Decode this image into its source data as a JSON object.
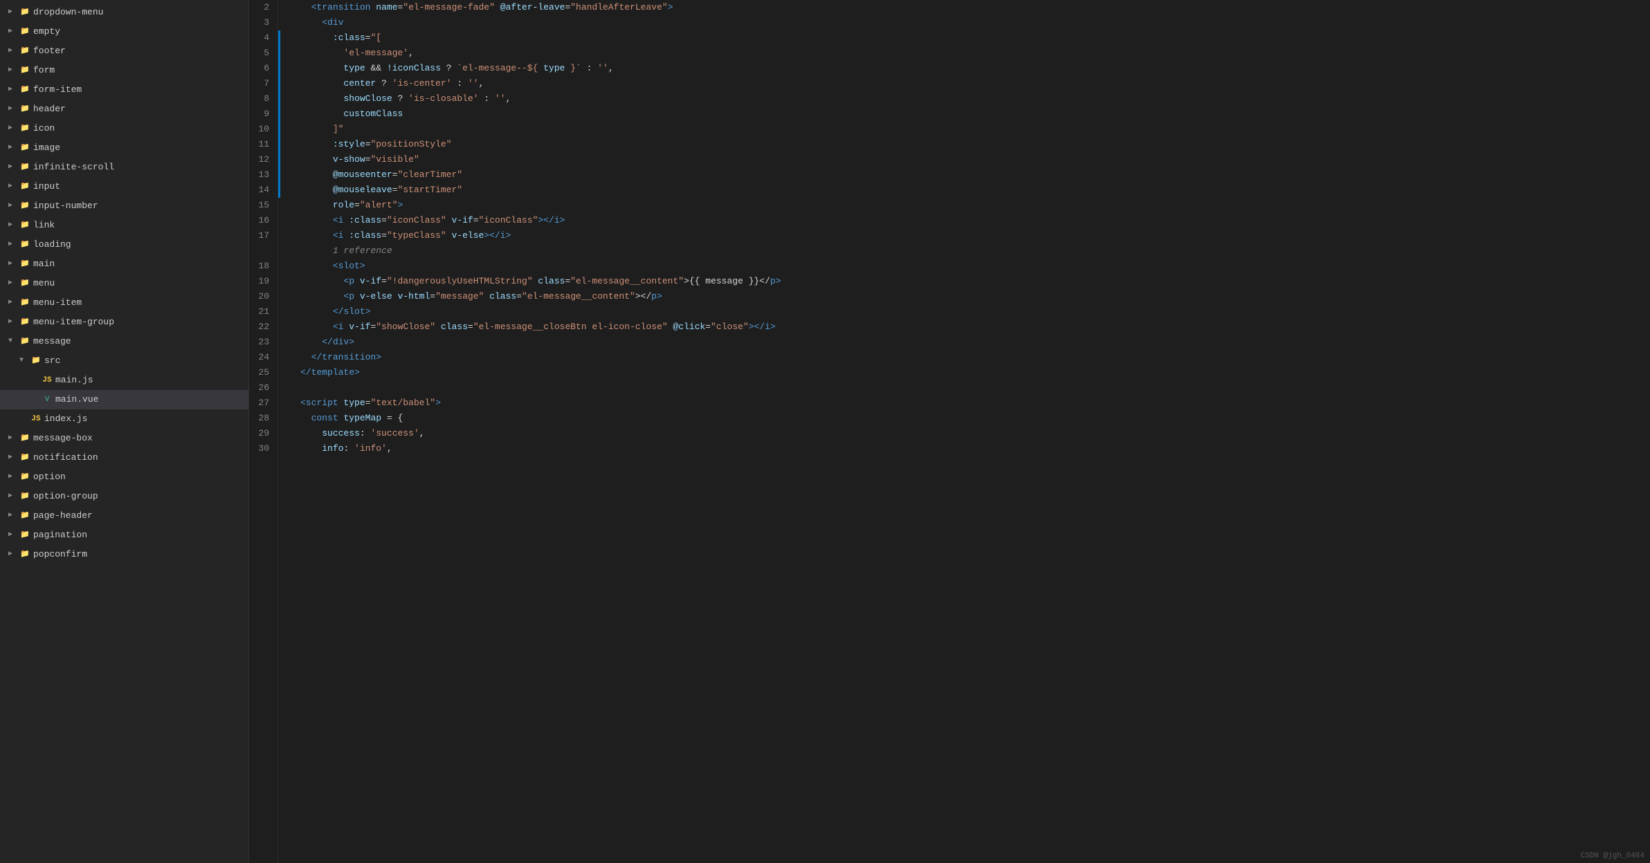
{
  "sidebar": {
    "items": [
      {
        "id": "dropdown-menu",
        "label": "dropdown-menu",
        "type": "folder",
        "collapsed": true,
        "indent": 0
      },
      {
        "id": "empty",
        "label": "empty",
        "type": "folder",
        "collapsed": true,
        "indent": 0
      },
      {
        "id": "footer",
        "label": "footer",
        "type": "folder",
        "collapsed": true,
        "indent": 0
      },
      {
        "id": "form",
        "label": "form",
        "type": "folder",
        "collapsed": true,
        "indent": 0
      },
      {
        "id": "form-item",
        "label": "form-item",
        "type": "folder",
        "collapsed": true,
        "indent": 0
      },
      {
        "id": "header",
        "label": "header",
        "type": "folder",
        "collapsed": true,
        "indent": 0
      },
      {
        "id": "icon",
        "label": "icon",
        "type": "folder",
        "collapsed": true,
        "indent": 0
      },
      {
        "id": "image",
        "label": "image",
        "type": "folder",
        "collapsed": true,
        "indent": 0
      },
      {
        "id": "infinite-scroll",
        "label": "infinite-scroll",
        "type": "folder",
        "collapsed": true,
        "indent": 0
      },
      {
        "id": "input",
        "label": "input",
        "type": "folder",
        "collapsed": true,
        "indent": 0
      },
      {
        "id": "input-number",
        "label": "input-number",
        "type": "folder",
        "collapsed": true,
        "indent": 0
      },
      {
        "id": "link",
        "label": "link",
        "type": "folder",
        "collapsed": true,
        "indent": 0
      },
      {
        "id": "loading",
        "label": "loading",
        "type": "folder",
        "collapsed": true,
        "indent": 0
      },
      {
        "id": "main",
        "label": "main",
        "type": "folder",
        "collapsed": true,
        "indent": 0
      },
      {
        "id": "menu",
        "label": "menu",
        "type": "folder",
        "collapsed": true,
        "indent": 0
      },
      {
        "id": "menu-item",
        "label": "menu-item",
        "type": "folder",
        "collapsed": true,
        "indent": 0
      },
      {
        "id": "menu-item-group",
        "label": "menu-item-group",
        "type": "folder",
        "collapsed": true,
        "indent": 0
      },
      {
        "id": "message",
        "label": "message",
        "type": "folder",
        "collapsed": false,
        "indent": 0
      },
      {
        "id": "src",
        "label": "src",
        "type": "folder",
        "collapsed": false,
        "indent": 1
      },
      {
        "id": "main-js",
        "label": "main.js",
        "type": "js",
        "indent": 2
      },
      {
        "id": "main-vue",
        "label": "main.vue",
        "type": "vue",
        "indent": 2,
        "selected": true
      },
      {
        "id": "index-js",
        "label": "index.js",
        "type": "js",
        "indent": 1
      },
      {
        "id": "message-box",
        "label": "message-box",
        "type": "folder",
        "collapsed": true,
        "indent": 0
      },
      {
        "id": "notification",
        "label": "notification",
        "type": "folder",
        "collapsed": true,
        "indent": 0
      },
      {
        "id": "option",
        "label": "option",
        "type": "folder",
        "collapsed": true,
        "indent": 0
      },
      {
        "id": "option-group",
        "label": "option-group",
        "type": "folder",
        "collapsed": true,
        "indent": 0
      },
      {
        "id": "page-header",
        "label": "page-header",
        "type": "folder",
        "collapsed": true,
        "indent": 0
      },
      {
        "id": "pagination",
        "label": "pagination",
        "type": "folder",
        "collapsed": true,
        "indent": 0
      },
      {
        "id": "popconfirm",
        "label": "popconfirm",
        "type": "folder",
        "collapsed": true,
        "indent": 0
      }
    ]
  },
  "editor": {
    "lines": [
      {
        "num": 2,
        "gutter": false,
        "content": [
          {
            "t": "  ",
            "c": ""
          },
          {
            "t": "<transition",
            "c": "c-tag"
          },
          {
            "t": " name",
            "c": "c-attr"
          },
          {
            "t": "=",
            "c": "c-white"
          },
          {
            "t": "\"el-message-fade\"",
            "c": "c-string"
          },
          {
            "t": " @after-leave",
            "c": "c-event"
          },
          {
            "t": "=",
            "c": "c-white"
          },
          {
            "t": "\"handleAfterLeave\"",
            "c": "c-string"
          },
          {
            "t": ">",
            "c": "c-tag"
          }
        ]
      },
      {
        "num": 3,
        "gutter": false,
        "content": [
          {
            "t": "    ",
            "c": ""
          },
          {
            "t": "<div",
            "c": "c-tag"
          }
        ]
      },
      {
        "num": 4,
        "gutter": true,
        "content": [
          {
            "t": "      ",
            "c": ""
          },
          {
            "t": ":class",
            "c": "c-attr"
          },
          {
            "t": "=",
            "c": "c-white"
          },
          {
            "t": "\"[",
            "c": "c-string"
          }
        ]
      },
      {
        "num": 5,
        "gutter": true,
        "content": [
          {
            "t": "        ",
            "c": ""
          },
          {
            "t": "'el-message'",
            "c": "c-string"
          },
          {
            "t": ",",
            "c": "c-white"
          }
        ]
      },
      {
        "num": 6,
        "gutter": true,
        "content": [
          {
            "t": "        ",
            "c": ""
          },
          {
            "t": "type",
            "c": "c-js-var"
          },
          {
            "t": " && ",
            "c": "c-white"
          },
          {
            "t": "!iconClass",
            "c": "c-js-var"
          },
          {
            "t": " ? ",
            "c": "c-white"
          },
          {
            "t": "`el-message--${",
            "c": "c-string"
          },
          {
            "t": " type ",
            "c": "c-js-var"
          },
          {
            "t": "}`",
            "c": "c-string"
          },
          {
            "t": " : ",
            "c": "c-white"
          },
          {
            "t": "''",
            "c": "c-string"
          },
          {
            "t": ",",
            "c": "c-white"
          }
        ]
      },
      {
        "num": 7,
        "gutter": true,
        "content": [
          {
            "t": "        ",
            "c": ""
          },
          {
            "t": "center",
            "c": "c-js-var"
          },
          {
            "t": " ? ",
            "c": "c-white"
          },
          {
            "t": "'is-center'",
            "c": "c-string"
          },
          {
            "t": " : ",
            "c": "c-white"
          },
          {
            "t": "''",
            "c": "c-string"
          },
          {
            "t": ",",
            "c": "c-white"
          }
        ]
      },
      {
        "num": 8,
        "gutter": true,
        "content": [
          {
            "t": "        ",
            "c": ""
          },
          {
            "t": "showClose",
            "c": "c-js-var"
          },
          {
            "t": " ? ",
            "c": "c-white"
          },
          {
            "t": "'is-closable'",
            "c": "c-string"
          },
          {
            "t": " : ",
            "c": "c-white"
          },
          {
            "t": "''",
            "c": "c-string"
          },
          {
            "t": ",",
            "c": "c-white"
          }
        ]
      },
      {
        "num": 9,
        "gutter": true,
        "content": [
          {
            "t": "        ",
            "c": ""
          },
          {
            "t": "customClass",
            "c": "c-js-var"
          }
        ]
      },
      {
        "num": 10,
        "gutter": true,
        "content": [
          {
            "t": "      ",
            "c": ""
          },
          {
            "t": "]\"",
            "c": "c-string"
          }
        ]
      },
      {
        "num": 11,
        "gutter": true,
        "content": [
          {
            "t": "      ",
            "c": ""
          },
          {
            "t": ":style",
            "c": "c-attr"
          },
          {
            "t": "=",
            "c": "c-white"
          },
          {
            "t": "\"positionStyle\"",
            "c": "c-string"
          }
        ]
      },
      {
        "num": 12,
        "gutter": true,
        "content": [
          {
            "t": "      ",
            "c": ""
          },
          {
            "t": "v-show",
            "c": "c-directive"
          },
          {
            "t": "=",
            "c": "c-white"
          },
          {
            "t": "\"visible\"",
            "c": "c-string"
          }
        ]
      },
      {
        "num": 13,
        "gutter": true,
        "content": [
          {
            "t": "      ",
            "c": ""
          },
          {
            "t": "@mouseenter",
            "c": "c-event"
          },
          {
            "t": "=",
            "c": "c-white"
          },
          {
            "t": "\"clearTimer\"",
            "c": "c-string"
          }
        ]
      },
      {
        "num": 14,
        "gutter": true,
        "content": [
          {
            "t": "      ",
            "c": ""
          },
          {
            "t": "@mouseleave",
            "c": "c-event"
          },
          {
            "t": "=",
            "c": "c-white"
          },
          {
            "t": "\"startTimer\"",
            "c": "c-string"
          }
        ]
      },
      {
        "num": 15,
        "gutter": false,
        "content": [
          {
            "t": "      ",
            "c": ""
          },
          {
            "t": "role",
            "c": "c-attr"
          },
          {
            "t": "=",
            "c": "c-white"
          },
          {
            "t": "\"alert\"",
            "c": "c-string"
          },
          {
            "t": ">",
            "c": "c-tag"
          }
        ]
      },
      {
        "num": 16,
        "gutter": false,
        "content": [
          {
            "t": "      ",
            "c": ""
          },
          {
            "t": "<i",
            "c": "c-tag"
          },
          {
            "t": " :class",
            "c": "c-attr"
          },
          {
            "t": "=",
            "c": "c-white"
          },
          {
            "t": "\"iconClass\"",
            "c": "c-string"
          },
          {
            "t": " v-if",
            "c": "c-directive"
          },
          {
            "t": "=",
            "c": "c-white"
          },
          {
            "t": "\"iconClass\"",
            "c": "c-string"
          },
          {
            "t": "></i>",
            "c": "c-tag"
          }
        ]
      },
      {
        "num": 17,
        "gutter": false,
        "content": [
          {
            "t": "      ",
            "c": ""
          },
          {
            "t": "<i",
            "c": "c-tag"
          },
          {
            "t": " :class",
            "c": "c-attr"
          },
          {
            "t": "=",
            "c": "c-white"
          },
          {
            "t": "\"typeClass\"",
            "c": "c-string"
          },
          {
            "t": " v-else",
            "c": "c-directive"
          },
          {
            "t": "></i>",
            "c": "c-tag"
          }
        ]
      },
      {
        "num": "ref",
        "gutter": false,
        "content": [
          {
            "t": "      ",
            "c": ""
          },
          {
            "t": "1 reference",
            "c": "c-ref"
          }
        ]
      },
      {
        "num": 18,
        "gutter": false,
        "content": [
          {
            "t": "      ",
            "c": ""
          },
          {
            "t": "<slot",
            "c": "c-tag"
          },
          {
            "t": ">",
            "c": "c-tag"
          }
        ]
      },
      {
        "num": 19,
        "gutter": false,
        "content": [
          {
            "t": "        ",
            "c": ""
          },
          {
            "t": "<p",
            "c": "c-tag"
          },
          {
            "t": " v-if",
            "c": "c-directive"
          },
          {
            "t": "=",
            "c": "c-white"
          },
          {
            "t": "\"!dangerouslyUseHTMLString\"",
            "c": "c-string"
          },
          {
            "t": " class",
            "c": "c-attr"
          },
          {
            "t": "=",
            "c": "c-white"
          },
          {
            "t": "\"el-message__content\"",
            "c": "c-string"
          },
          {
            "t": ">{{ message }}</",
            "c": "c-white"
          },
          {
            "t": "p",
            "c": "c-tag"
          },
          {
            "t": ">",
            "c": "c-tag"
          }
        ]
      },
      {
        "num": 20,
        "gutter": false,
        "content": [
          {
            "t": "        ",
            "c": ""
          },
          {
            "t": "<p",
            "c": "c-tag"
          },
          {
            "t": " v-else",
            "c": "c-directive"
          },
          {
            "t": " v-html",
            "c": "c-directive"
          },
          {
            "t": "=",
            "c": "c-white"
          },
          {
            "t": "\"message\"",
            "c": "c-string"
          },
          {
            "t": " class",
            "c": "c-attr"
          },
          {
            "t": "=",
            "c": "c-white"
          },
          {
            "t": "\"el-message__content\"",
            "c": "c-string"
          },
          {
            "t": "></",
            "c": "c-white"
          },
          {
            "t": "p",
            "c": "c-tag"
          },
          {
            "t": ">",
            "c": "c-tag"
          }
        ]
      },
      {
        "num": 21,
        "gutter": false,
        "content": [
          {
            "t": "      ",
            "c": ""
          },
          {
            "t": "</slot",
            "c": "c-tag"
          },
          {
            "t": ">",
            "c": "c-tag"
          }
        ]
      },
      {
        "num": 22,
        "gutter": false,
        "content": [
          {
            "t": "      ",
            "c": ""
          },
          {
            "t": "<i",
            "c": "c-tag"
          },
          {
            "t": " v-if",
            "c": "c-directive"
          },
          {
            "t": "=",
            "c": "c-white"
          },
          {
            "t": "\"showClose\"",
            "c": "c-string"
          },
          {
            "t": " class",
            "c": "c-attr"
          },
          {
            "t": "=",
            "c": "c-white"
          },
          {
            "t": "\"el-message__closeBtn el-icon-close\"",
            "c": "c-string"
          },
          {
            "t": " @click",
            "c": "c-event"
          },
          {
            "t": "=",
            "c": "c-white"
          },
          {
            "t": "\"close\"",
            "c": "c-string"
          },
          {
            "t": "></i>",
            "c": "c-tag"
          }
        ]
      },
      {
        "num": 23,
        "gutter": false,
        "content": [
          {
            "t": "    ",
            "c": ""
          },
          {
            "t": "</div",
            "c": "c-tag"
          },
          {
            "t": ">",
            "c": "c-tag"
          }
        ]
      },
      {
        "num": 24,
        "gutter": false,
        "content": [
          {
            "t": "  ",
            "c": ""
          },
          {
            "t": "</transition",
            "c": "c-tag"
          },
          {
            "t": ">",
            "c": "c-tag"
          }
        ]
      },
      {
        "num": 25,
        "gutter": false,
        "content": [
          {
            "t": "</template",
            "c": "c-tag"
          },
          {
            "t": ">",
            "c": "c-tag"
          }
        ]
      },
      {
        "num": 26,
        "gutter": false,
        "content": []
      },
      {
        "num": 27,
        "gutter": false,
        "content": [
          {
            "t": "<script",
            "c": "c-tag"
          },
          {
            "t": " type",
            "c": "c-attr"
          },
          {
            "t": "=",
            "c": "c-white"
          },
          {
            "t": "\"text/babel\"",
            "c": "c-string"
          },
          {
            "t": ">",
            "c": "c-tag"
          }
        ]
      },
      {
        "num": 28,
        "gutter": false,
        "content": [
          {
            "t": "  ",
            "c": ""
          },
          {
            "t": "const",
            "c": "c-js-keyword"
          },
          {
            "t": " ",
            "c": ""
          },
          {
            "t": "typeMap",
            "c": "c-js-var"
          },
          {
            "t": " = {",
            "c": "c-white"
          }
        ]
      },
      {
        "num": 29,
        "gutter": false,
        "content": [
          {
            "t": "    ",
            "c": ""
          },
          {
            "t": "success",
            "c": "c-js-prop"
          },
          {
            "t": ": ",
            "c": "c-white"
          },
          {
            "t": "'success'",
            "c": "c-js-string"
          },
          {
            "t": ",",
            "c": "c-white"
          }
        ]
      },
      {
        "num": 30,
        "gutter": false,
        "content": [
          {
            "t": "    ",
            "c": ""
          },
          {
            "t": "info",
            "c": "c-js-prop"
          },
          {
            "t": ": ",
            "c": "c-white"
          },
          {
            "t": "'info'",
            "c": "c-js-string"
          },
          {
            "t": ",",
            "c": "c-white"
          }
        ]
      }
    ]
  },
  "watermark": "CSDN @jgh_0484"
}
